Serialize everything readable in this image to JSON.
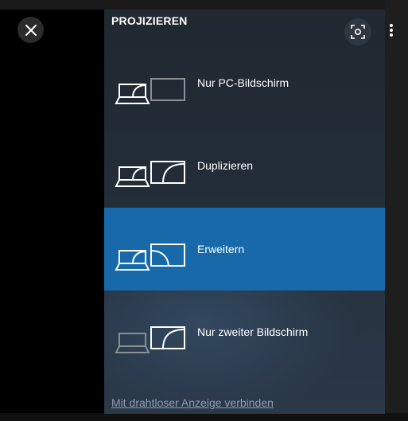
{
  "viewer": {
    "close_icon": "close-icon",
    "more_icon": "more-vertical-icon"
  },
  "panel": {
    "title": "PROJIZIEREN",
    "capture_icon": "screen-capture-icon",
    "selected_option": "Erweitern",
    "options": [
      {
        "label": "Nur PC-Bildschirm",
        "icon": "pc-screen-only-icon"
      },
      {
        "label": "Duplizieren",
        "icon": "duplicate-icon"
      },
      {
        "label": "Erweitern",
        "icon": "extend-icon"
      },
      {
        "label": "Nur zweiter Bildschirm",
        "icon": "second-screen-only-icon"
      }
    ],
    "wireless_link": "Mit drahtloser Anzeige verbinden"
  },
  "colors": {
    "accent": "#1769aa",
    "panel_bg": "#232d38",
    "link": "#8a9db2"
  }
}
